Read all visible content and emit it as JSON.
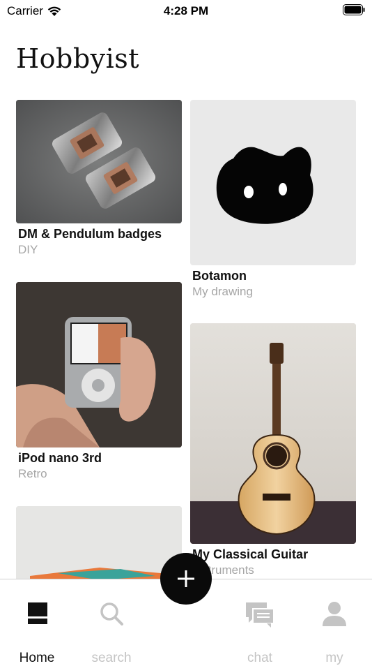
{
  "status_bar": {
    "carrier": "Carrier",
    "time": "4:28 PM"
  },
  "app": {
    "title": "Hobbyist"
  },
  "feed": [
    {
      "title": "DM & Pendulum badges",
      "category": "DIY"
    },
    {
      "title": "Botamon",
      "category": "My drawing"
    },
    {
      "title": "iPod nano 3rd",
      "category": "Retro"
    },
    {
      "title": "My Classical Guitar",
      "category": "Instruments"
    },
    {
      "title": "",
      "category": ""
    }
  ],
  "tabs": [
    {
      "label": "Home",
      "icon": "home-icon",
      "active": true
    },
    {
      "label": "search",
      "icon": "search-icon",
      "active": false
    },
    {
      "label": "chat",
      "icon": "chat-icon",
      "active": false
    },
    {
      "label": "my",
      "icon": "profile-icon",
      "active": false
    }
  ],
  "fab": {
    "icon": "plus-icon"
  },
  "colors": {
    "active_tab": "#111111",
    "inactive_tab": "#c4c4c4",
    "subtitle": "#a6a6a6",
    "fab": "#0a0a0a"
  }
}
